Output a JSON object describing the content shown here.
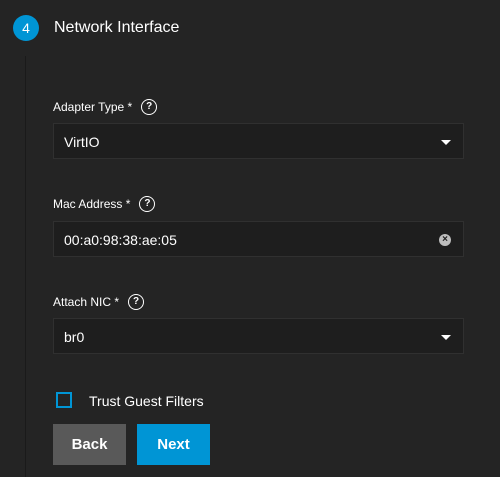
{
  "step": {
    "number": "4",
    "title": "Network Interface"
  },
  "fields": {
    "adapter_type": {
      "label": "Adapter Type *",
      "value": "VirtIO",
      "help": "?"
    },
    "mac_address": {
      "label": "Mac Address *",
      "value": "00:a0:98:38:ae:05",
      "help": "?"
    },
    "attach_nic": {
      "label": "Attach NIC *",
      "value": "br0",
      "help": "?"
    }
  },
  "trust_guest_filters": {
    "label": "Trust Guest Filters",
    "checked": false
  },
  "buttons": {
    "back": "Back",
    "next": "Next"
  },
  "colors": {
    "accent": "#0095d5",
    "background": "#242424",
    "field": "#1e1e1e",
    "back_button": "#595959"
  },
  "icons": [
    "help-icon",
    "dropdown-arrow-icon",
    "clear-icon"
  ]
}
